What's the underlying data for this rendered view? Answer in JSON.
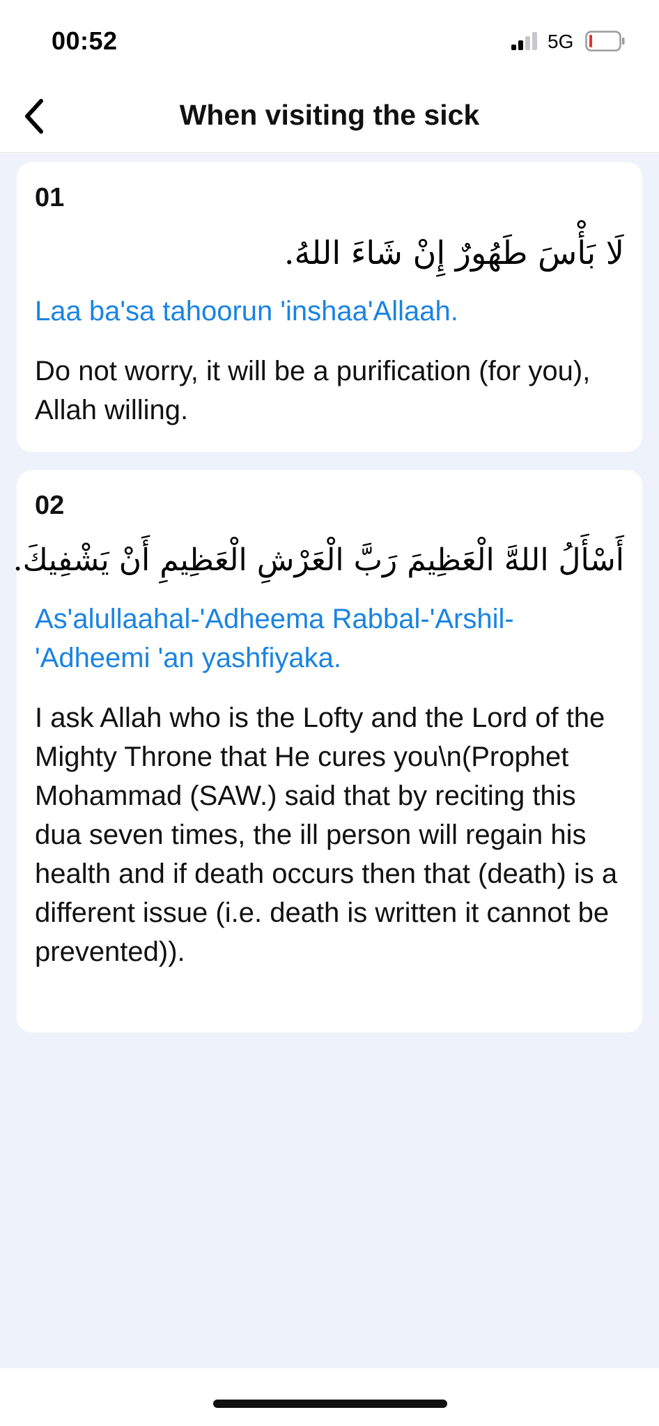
{
  "status_bar": {
    "time": "00:52",
    "network": "5G",
    "signal_bars": 2,
    "battery_level": 0.05,
    "battery_color": "#e3342f"
  },
  "header": {
    "title": "When visiting the sick",
    "back_icon": "chevron-left-icon"
  },
  "duas": [
    {
      "number": "01",
      "arabic": "لَا بَأْسَ طَهُورٌ إِنْ شَاءَ اللهُ.",
      "transliteration": "Laa ba'sa tahoorun 'inshaa'Allaah.",
      "translation": "Do not worry, it will be a purification (for you), Allah willing."
    },
    {
      "number": "02",
      "arabic": "أَسْأَلُ اللهَّ الْعَظِيمَ رَبَّ الْعَرْشِ الْعَظِيمِ أَنْ يَشْفِيكَ.",
      "transliteration": "As'alullaahal-'Adheema Rabbal-'Arshil-'Adheemi 'an yashfiyaka.",
      "translation": "I ask Allah who is the Lofty and the Lord of the Mighty Throne that He cures you\\n(Prophet Mohammad (SAW.) said that by reciting this dua seven times, the ill person will regain his health and if death occurs then that (death) is a different issue (i.e. death is written it cannot be prevented))."
    }
  ],
  "colors": {
    "accent": "#1a83e3",
    "background": "#eef3fb",
    "card": "#ffffff"
  }
}
